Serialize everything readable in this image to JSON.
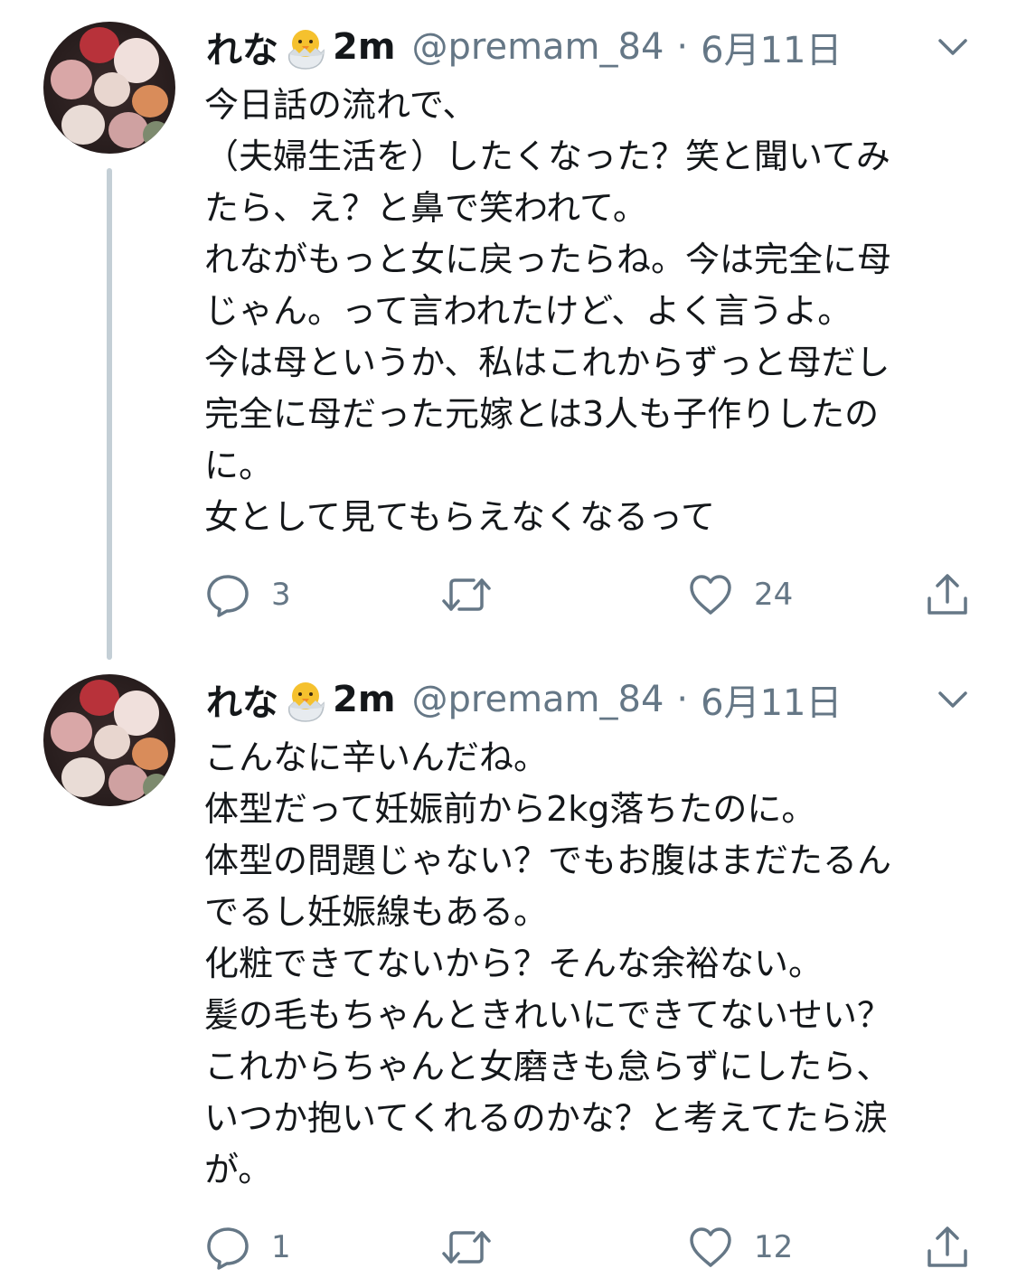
{
  "tweets": [
    {
      "author_name": "れな",
      "name_suffix": "2m",
      "handle": "@premam_84",
      "separator": "·",
      "date": "6月11日",
      "emoji_icon": "hatching-chick-icon",
      "lines": [
        "今日話の流れで、",
        "（夫婦生活を）したくなった？笑と聞いてみ",
        "たら、え？と鼻で笑われて。",
        "れながもっと女に戻ったらね。今は完全に母",
        "じゃん。って言われたけど、よく言うよ。",
        "今は母というか、私はこれからずっと母だし",
        "完全に母だった元嫁とは3人も子作りしたの",
        "に。",
        "女として見てもらえなくなるって"
      ],
      "reply_count": "3",
      "retweet_count": "",
      "like_count": "24"
    },
    {
      "author_name": "れな",
      "name_suffix": "2m",
      "handle": "@premam_84",
      "separator": "·",
      "date": "6月11日",
      "emoji_icon": "hatching-chick-icon",
      "lines": [
        "こんなに辛いんだね。",
        "体型だって妊娠前から2kg落ちたのに。",
        "体型の問題じゃない？でもお腹はまだたるん",
        "でるし妊娠線もある。",
        "化粧できてないから？そんな余裕ない。",
        "髪の毛もちゃんときれいにできてないせい？",
        "これからちゃんと女磨きも怠らずにしたら、",
        "いつか抱いてくれるのかな？と考えてたら涙",
        "が。"
      ],
      "reply_count": "1",
      "retweet_count": "",
      "like_count": "12"
    }
  ],
  "colors": {
    "text": "#14171a",
    "secondary": "#657786",
    "thread_line": "#c4cfd6",
    "icon": "#657786"
  }
}
